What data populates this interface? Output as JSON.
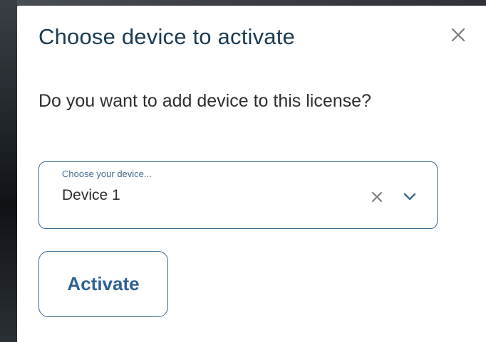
{
  "dialog": {
    "title": "Choose device to activate",
    "message": "Do you want to add device to this license?",
    "close_icon": "close-icon"
  },
  "device_select": {
    "label": "Choose your device...",
    "selected_value": "Device 1",
    "clear_icon": "clear-icon",
    "dropdown_icon": "chevron-down-icon"
  },
  "actions": {
    "activate_label": "Activate"
  },
  "colors": {
    "title": "#1b3a52",
    "accent": "#3d6a8f",
    "button_text": "#2f6390",
    "backdrop": "#1c2126"
  }
}
